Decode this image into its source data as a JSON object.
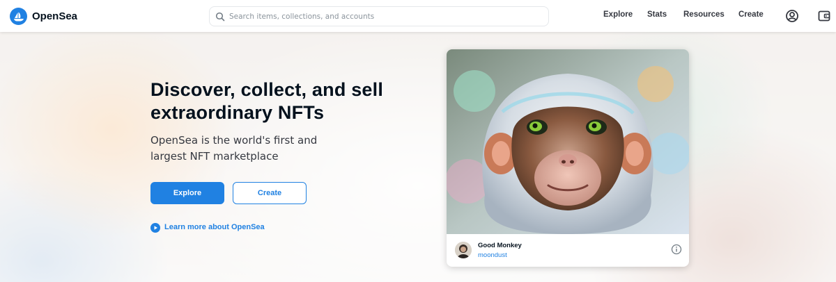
{
  "header": {
    "brand": "OpenSea",
    "search_placeholder": "Search items, collections, and accounts",
    "nav": [
      "Explore",
      "Stats",
      "Resources",
      "Create"
    ],
    "icons": [
      "account-icon",
      "wallet-icon"
    ]
  },
  "hero": {
    "title": "Discover, collect, and sell extraordinary NFTs",
    "subtitle": "OpenSea is the world's first and largest NFT marketplace",
    "explore_label": "Explore",
    "create_label": "Create",
    "learn_more": "Learn more about OpenSea"
  },
  "featured": {
    "name": "Good Monkey",
    "creator": "moondust"
  },
  "colors": {
    "accent": "#2081e2",
    "text_dark": "#04111d"
  }
}
